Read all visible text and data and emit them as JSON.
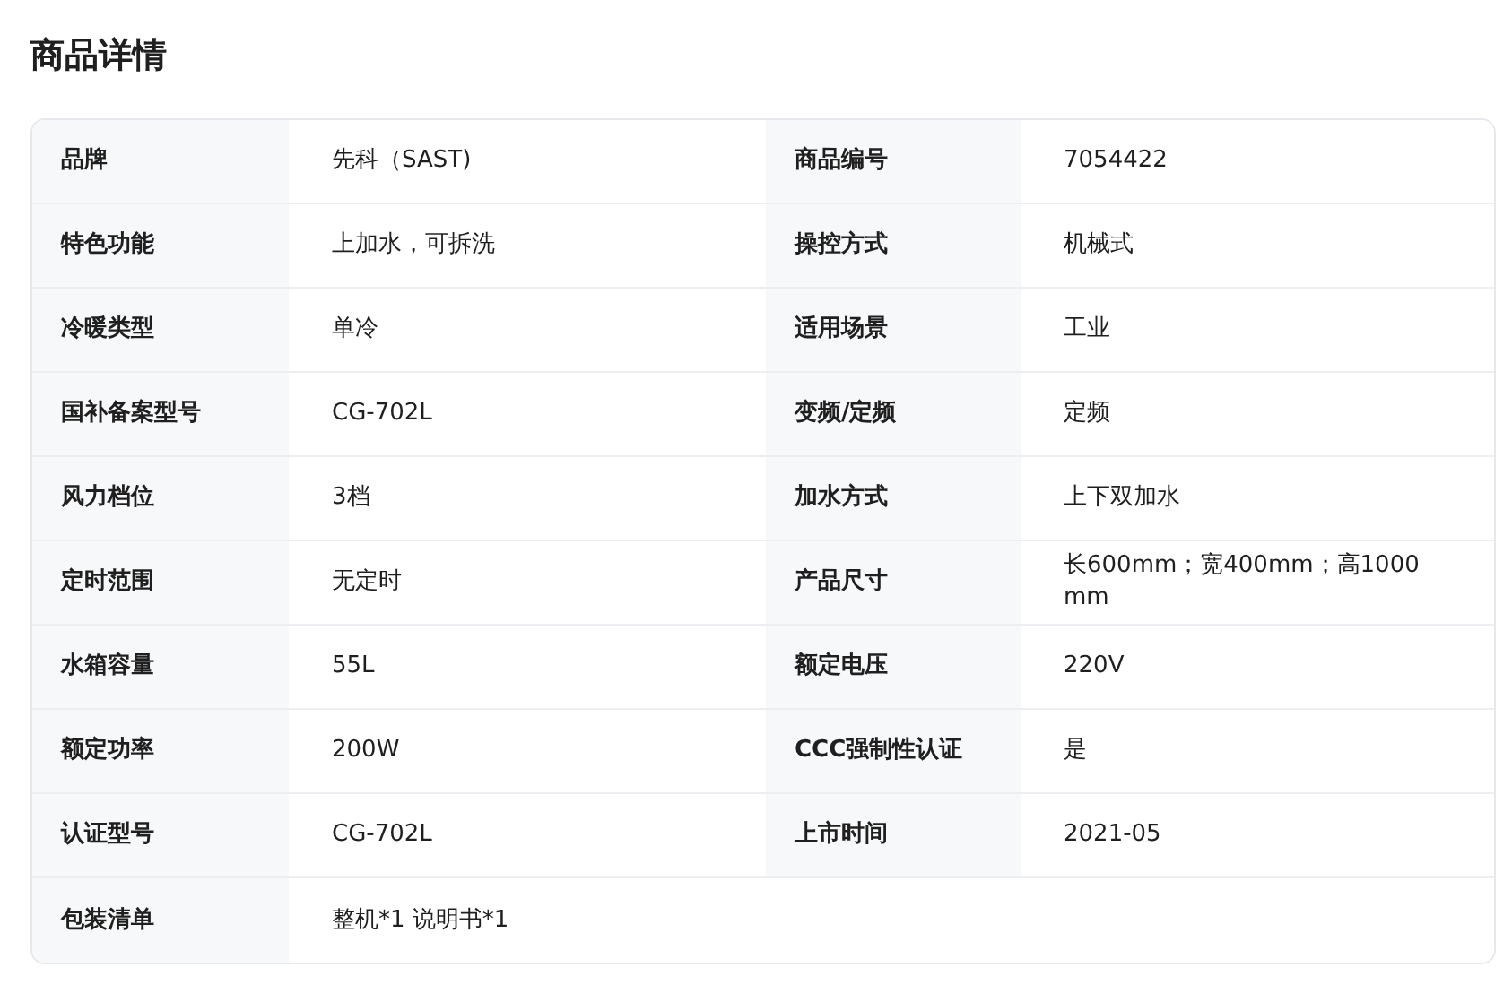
{
  "title": "商品详情",
  "rows": [
    [
      {
        "label": "品牌",
        "value": "先科（SAST)"
      },
      {
        "label": "商品编号",
        "value": "7054422"
      }
    ],
    [
      {
        "label": "特色功能",
        "value": "上加水，可拆洗"
      },
      {
        "label": "操控方式",
        "value": "机械式"
      }
    ],
    [
      {
        "label": "冷暖类型",
        "value": "单冷"
      },
      {
        "label": "适用场景",
        "value": "工业"
      }
    ],
    [
      {
        "label": "国补备案型号",
        "value": "CG-702L"
      },
      {
        "label": "变频/定频",
        "value": "定频"
      }
    ],
    [
      {
        "label": "风力档位",
        "value": "3档"
      },
      {
        "label": "加水方式",
        "value": "上下双加水"
      }
    ],
    [
      {
        "label": "定时范围",
        "value": "无定时"
      },
      {
        "label": "产品尺寸",
        "value": "长600mm；宽400mm；高1000 mm"
      }
    ],
    [
      {
        "label": "水箱容量",
        "value": "55L"
      },
      {
        "label": "额定电压",
        "value": "220V"
      }
    ],
    [
      {
        "label": "额定功率",
        "value": "200W"
      },
      {
        "label": "CCC强制性认证",
        "value": "是"
      }
    ],
    [
      {
        "label": "认证型号",
        "value": "CG-702L"
      },
      {
        "label": "上市时间",
        "value": "2021-05"
      }
    ],
    [
      {
        "label": "包装清单",
        "value": "整机*1 说明书*1"
      }
    ]
  ]
}
